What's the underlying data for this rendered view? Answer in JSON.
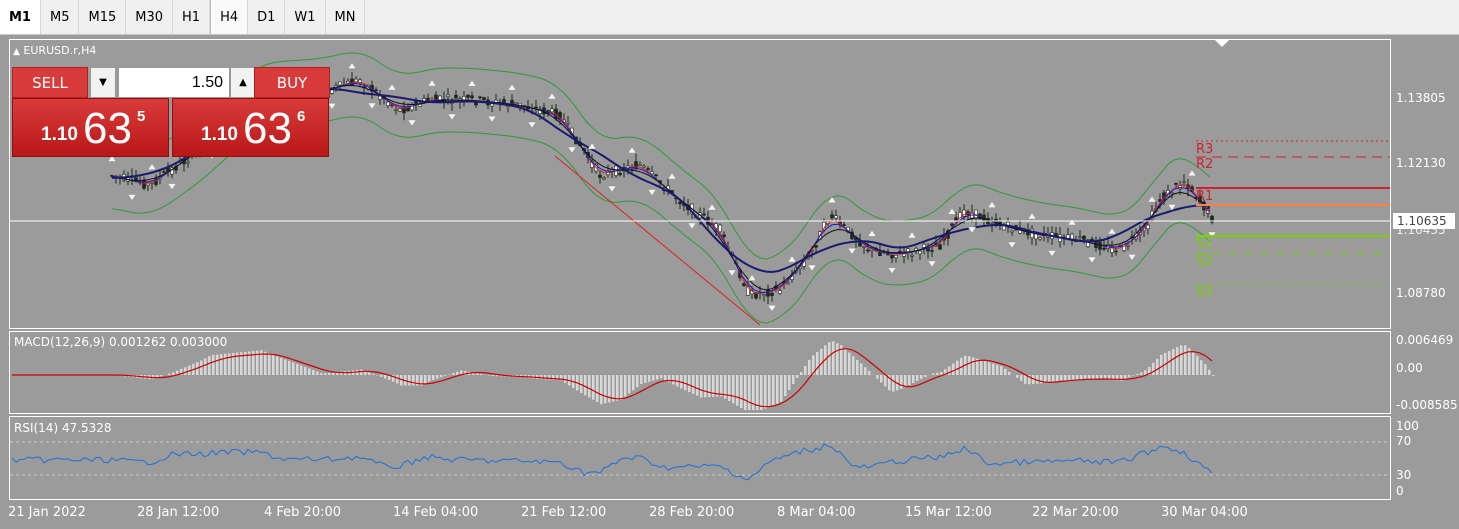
{
  "timeframes": {
    "items": [
      "M1",
      "M5",
      "M15",
      "M30",
      "H1",
      "H4",
      "D1",
      "W1",
      "MN"
    ],
    "active": "H4"
  },
  "chart": {
    "symbol_label": "EURUSD.r,H4",
    "current_price": "1.10635",
    "overlapped_price": "1.10435",
    "price_ticks": [
      "1.13805",
      "1.12130",
      "1.10635",
      "1.08780"
    ],
    "pivots": [
      "R3",
      "R2",
      "R1",
      "S1",
      "S2",
      "S3"
    ],
    "colors": {
      "background": "#9b9b9b",
      "resistance": "#d02030",
      "support": "#7ad000",
      "pivot_mid": "#ff8040",
      "ma_fast": "#e02020",
      "ma_mid": "#1a1acc",
      "ma_slow": "#1a1a6e",
      "bollinger": "#2e9a3a",
      "rsi_line": "#1e6fd9",
      "macd_signal": "#cc0000",
      "trendline": "#e02020"
    }
  },
  "one_click": {
    "sell_label": "SELL",
    "buy_label": "BUY",
    "volume": "1.50",
    "sell_price": {
      "prefix": "1.10",
      "main": "63",
      "sup": "5"
    },
    "buy_price": {
      "prefix": "1.10",
      "main": "63",
      "sup": "6"
    },
    "down_icon": "down-arrow-icon",
    "up_icon": "up-arrow-icon"
  },
  "macd": {
    "label": "MACD(12,26,9) 0.001262 0.003000",
    "ticks": [
      "0.006469",
      "0.00",
      "-0.008585"
    ]
  },
  "rsi": {
    "label": "RSI(14) 47.5328",
    "ticks": [
      "100",
      "70",
      "30",
      "0"
    ]
  },
  "dates": [
    "21 Jan 2022",
    "28 Jan 12:00",
    "4 Feb 20:00",
    "14 Feb 04:00",
    "21 Feb 12:00",
    "28 Feb 20:00",
    "8 Mar 04:00",
    "15 Mar 12:00",
    "22 Mar 20:00",
    "30 Mar 04:00"
  ]
}
